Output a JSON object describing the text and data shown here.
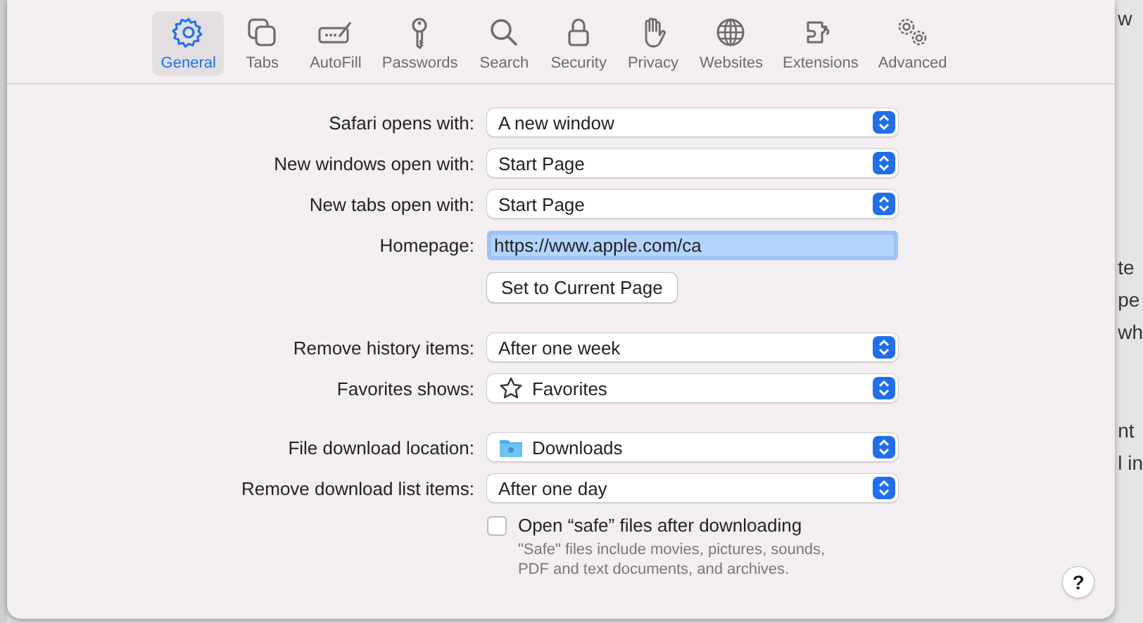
{
  "background_text": [
    "w",
    "te",
    "pe",
    "wh",
    "nt",
    "l in"
  ],
  "toolbar": [
    {
      "label": "General",
      "selected": true
    },
    {
      "label": "Tabs",
      "selected": false
    },
    {
      "label": "AutoFill",
      "selected": false
    },
    {
      "label": "Passwords",
      "selected": false
    },
    {
      "label": "Search",
      "selected": false
    },
    {
      "label": "Security",
      "selected": false
    },
    {
      "label": "Privacy",
      "selected": false
    },
    {
      "label": "Websites",
      "selected": false
    },
    {
      "label": "Extensions",
      "selected": false
    },
    {
      "label": "Advanced",
      "selected": false
    }
  ],
  "sections": [
    [
      {
        "kind": "popup",
        "label": "Safari opens with:",
        "value": "A new window"
      },
      {
        "kind": "popup",
        "label": "New windows open with:",
        "value": "Start Page"
      },
      {
        "kind": "popup",
        "label": "New tabs open with:",
        "value": "Start Page"
      },
      {
        "kind": "field",
        "label": "Homepage:",
        "value": "https://www.apple.com/ca"
      },
      {
        "kind": "button",
        "label": "Set to Current Page"
      }
    ],
    [
      {
        "kind": "popup",
        "label": "Remove history items:",
        "value": "After one week"
      },
      {
        "kind": "star_popup",
        "label": "Favorites shows:",
        "value": "Favorites"
      }
    ],
    [
      {
        "kind": "folder_popup",
        "label": "File download location:",
        "value": "Downloads"
      },
      {
        "kind": "popup",
        "label": "Remove download list items:",
        "value": "After one day"
      },
      {
        "kind": "checkbox",
        "label": "Open “safe” files after downloading",
        "checked": false
      },
      {
        "kind": "note",
        "text": "\"Safe\" files include movies, pictures, sounds, PDF and text documents, and archives."
      }
    ]
  ],
  "help_button": "?"
}
